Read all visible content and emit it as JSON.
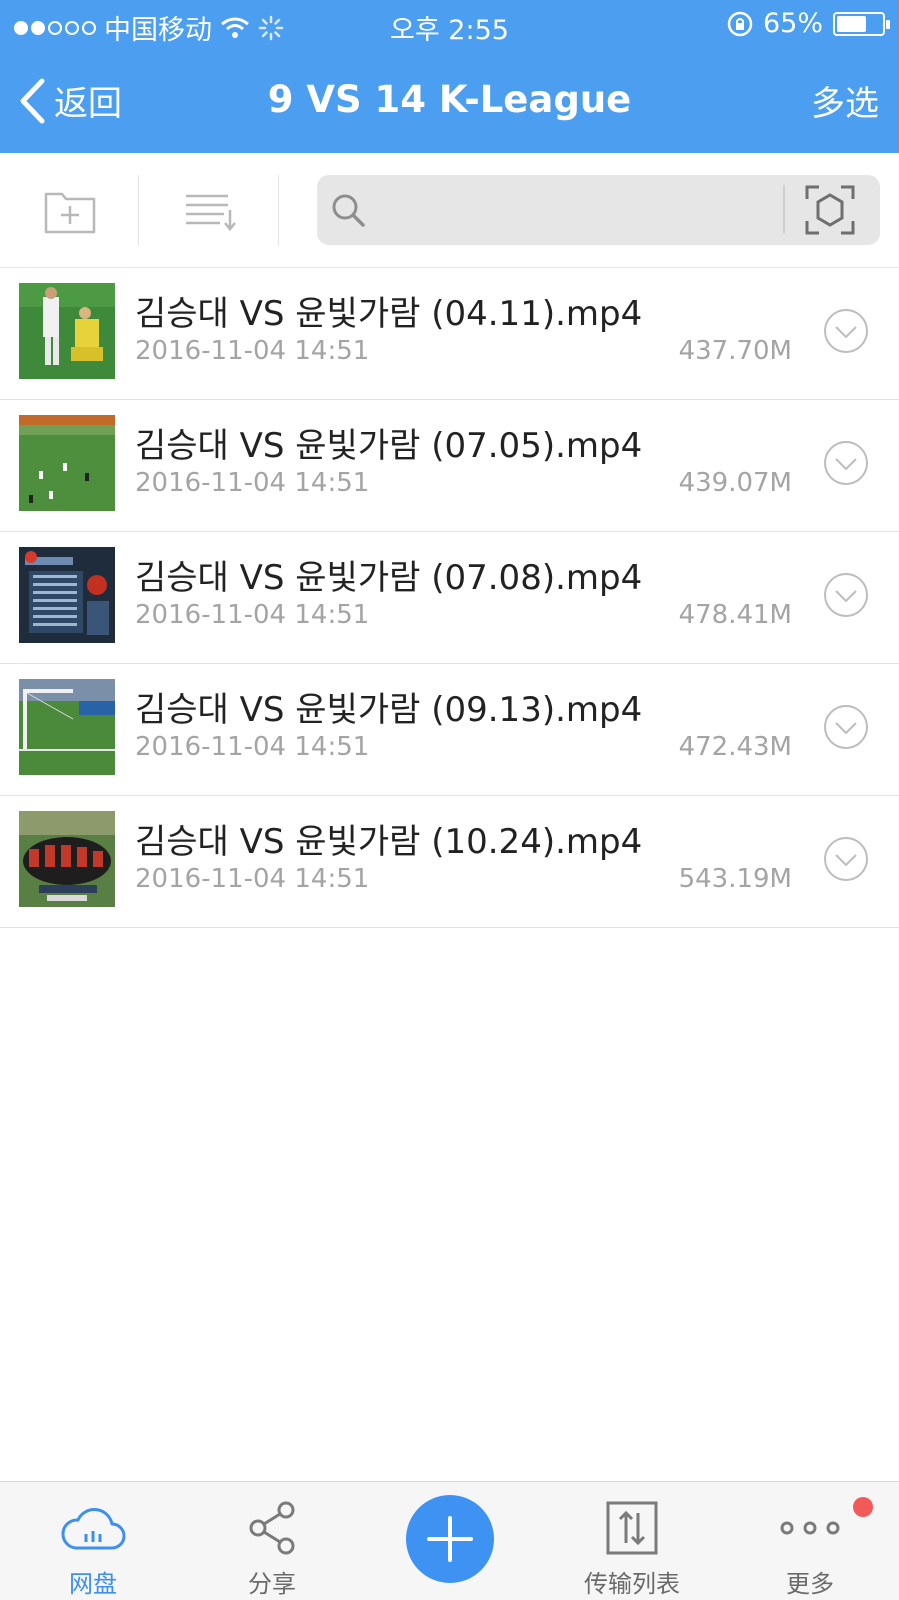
{
  "status": {
    "carrier": "中国移动",
    "time": "오후 2:55",
    "battery": "65%",
    "battery_level": 0.65
  },
  "nav": {
    "back_label": "返回",
    "title": "9 VS 14 K-League",
    "multiselect_label": "多选"
  },
  "toolbar": {
    "icons": [
      "folder-add-icon",
      "sort-icon",
      "search-icon",
      "scan-icon"
    ],
    "search_value": "",
    "search_placeholder": ""
  },
  "files": [
    {
      "name": "김승대 VS 윤빛가람 (04.11).mp4",
      "date": "2016-11-04 14:51",
      "size": "437.70M"
    },
    {
      "name": "김승대 VS 윤빛가람 (07.05).mp4",
      "date": "2016-11-04 14:51",
      "size": "439.07M"
    },
    {
      "name": "김승대 VS 윤빛가람 (07.08).mp4",
      "date": "2016-11-04 14:51",
      "size": "478.41M"
    },
    {
      "name": "김승대 VS 윤빛가람 (09.13).mp4",
      "date": "2016-11-04 14:51",
      "size": "472.43M"
    },
    {
      "name": "김승대 VS 윤빛가람 (10.24).mp4",
      "date": "2016-11-04 14:51",
      "size": "543.19M"
    }
  ],
  "tabs": [
    {
      "label": "网盘",
      "icon": "cloud-icon",
      "active": true
    },
    {
      "label": "分享",
      "icon": "share-icon",
      "active": false
    },
    {
      "label": "",
      "icon": "plus-icon",
      "active": false
    },
    {
      "label": "传输列表",
      "icon": "transfer-icon",
      "active": false
    },
    {
      "label": "更多",
      "icon": "more-icon",
      "active": false
    }
  ],
  "colors": {
    "brand": "#4b9ef0",
    "active_tab": "#3d8ff0",
    "badge": "#f25a5a"
  }
}
